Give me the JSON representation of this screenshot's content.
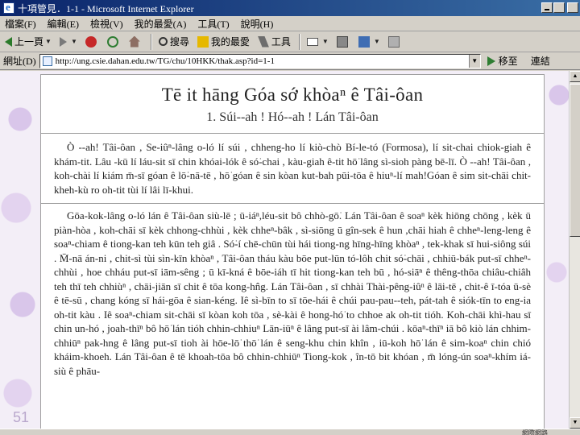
{
  "window": {
    "title": "十項管見．1-1 - Microsoft Internet Explorer"
  },
  "menu": [
    "檔案(F)",
    "編輯(E)",
    "檢視(V)",
    "我的最愛(A)",
    "工具(T)",
    "說明(H)"
  ],
  "toolbar": {
    "back": "上一頁",
    "search": "搜尋",
    "favorites": "我的最愛",
    "tools": "工具"
  },
  "address": {
    "label": "網址(D)",
    "url": "http://ung.csie.dahan.edu.tw/TG/chu/10HKK/thak.asp?id=1-1",
    "go": "移至",
    "links": "連結"
  },
  "document": {
    "title": "Tē it hāng Góa sớ khòaⁿ ê Tâi-ôan",
    "subtitle": "1. Súi--ah ! Hó--ah ! Lán Tâi-ôan",
    "paragraph1": "Ò --ah! Tâi-ôan , Se-iûⁿ-lâng o-ló lí súi , chheng-ho lí kiò-chò Bí-le-tó (Formosa), lí sit-chai chiok-giah ê khám-tit. Lâu -kū lí láu-sit sī chin khóai-lók ê só͘-chai , kàu-giah ê-tit hō͘ lâng sì-sioh pàng bē-lī. Ò --ah! Tâi-ôan , koh-chài lí kiám m̄-sī góan ê lō͘-nā-tē , hō͘ góan ê sin kòan kut-bah pūi-tōa ê hiuⁿ-lí mah!Góan ê sim sit-chāi chit-kheh-kù ro oh-tit tùi lí lâi lī-khui.",
    "paragraph2": "Gōa-kok-lâng o-ló lán ê Tâi-ôan siù-lē ; ū-iáⁿ,léu-sit bô chhò-gō͘. Lán Tâi-ôan ê soaⁿ kèk hiōng chōng , kèk ū piàn-hòa , koh-chāi sī kèk chhong-chhùi , kèk chheⁿ-bâk , sì-siōng ū gîn-sek ê hun ,chāi hiah ê chheⁿ-leng-leng ê soaⁿ-chiam ê tiong-kan teh kūn teh giâ . Só͘-í chē-chūn tùi hái tiong-ng hīng-hīng khòaⁿ , tek-khak sī hui-siông súi . M̄-nā án-ni , chit-sì tùi sìn-kīn khòaⁿ , Tâi-ôan tháu kàu bōe put-lūn tó-lôh chit só͘-chāi , chhiū-bák put-sī chheⁿ-chhùi , hoe chháu put-sī iām-sêng ; ū kī-kná ê bōe-iáh tī hit tiong-kan teh bū , hó-siāⁿ ê thêng-thōa chiâu-chiâh teh thī teh chhiùⁿ , chāi-jiān sī chit ê tōa kong-hn̂g. Lán Tâi-ôan , sī chhài Thài-pêng-iûⁿ ê lāi-tē , chit-ê ī-tóa ū-sè ê tē-sū , chang kóng sī hái-gōa ê sian-kéng. Iê sì-bīn to sī tōe-hái ê chúi pau-pau--teh, pát-tah ê siók-tīn to eng-ia oh-tit kàu . Iê soaⁿ-chiam sit-chāi sī kòan koh tōa , sè-kài ê hong-hó͘ to chhoe ak oh-tit tióh. Koh-chāi khì-hau sī chin un-hó , joah-thīⁿ bô hō͘ lán tióh chhin-chhiuⁿ Lān-iūⁿ ê lâng put-sī ài lâm-chúi . kōaⁿ-thīⁿ iā bô kiò lán chhim-chhiūⁿ pak-hng ê lâng put-sī tioh ài hōe-lō͘ thō͘ lán ê seng-khu chin khîn , iū-koh hō͘ lán ê sim-koaⁿ chin chió kháim-khoeh. Lán Tâi-ôan ê tē khoah-tōa bô chhin-chhiūⁿ Tiong-kok , în-tō bit khóan , m̄ lóng-ún soaⁿ-khím iá-siù ê phāu-"
  },
  "slide_number": "51",
  "status": {
    "zone": "網際網路"
  }
}
